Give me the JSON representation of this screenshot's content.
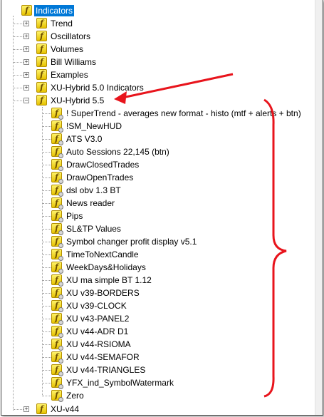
{
  "tree": {
    "root": {
      "label": "Indicators",
      "icon": "indicator-folder-icon"
    },
    "folders": [
      {
        "label": "Trend",
        "expander": "+"
      },
      {
        "label": "Oscillators",
        "expander": "+"
      },
      {
        "label": "Volumes",
        "expander": "+"
      },
      {
        "label": "Bill Williams",
        "expander": "+"
      },
      {
        "label": "Examples",
        "expander": "+"
      },
      {
        "label": "XU-Hybrid 5.0 Indicators",
        "expander": "+"
      },
      {
        "label": "XU-Hybrid 5.5",
        "expander": "−"
      }
    ],
    "items": [
      {
        "label": "! SuperTrend - averages new format - histo  (mtf + alerts + btn)"
      },
      {
        "label": "!SM_NewHUD"
      },
      {
        "label": "ATS V3.0"
      },
      {
        "label": "Auto Sessions 22,145 (btn)"
      },
      {
        "label": "DrawClosedTrades"
      },
      {
        "label": "DrawOpenTrades"
      },
      {
        "label": "dsl obv 1.3 BT"
      },
      {
        "label": "News reader"
      },
      {
        "label": "Pips"
      },
      {
        "label": "SL&TP Values"
      },
      {
        "label": "Symbol changer profit display v5.1"
      },
      {
        "label": "TimeToNextCandle"
      },
      {
        "label": "WeekDays&Holidays"
      },
      {
        "label": "XU ma simple BT 1.12"
      },
      {
        "label": "XU v39-BORDERS"
      },
      {
        "label": "XU v39-CLOCK"
      },
      {
        "label": "XU v43-PANEL2"
      },
      {
        "label": "XU v44-ADR D1"
      },
      {
        "label": "XU v44-RSIOMA"
      },
      {
        "label": "XU v44-SEMAFOR"
      },
      {
        "label": "XU v44-TRIANGLES"
      },
      {
        "label": "YFX_ind_SymbolWatermark"
      },
      {
        "label": "Zero"
      }
    ],
    "last_folder": {
      "label": "XU-v44",
      "expander": "+"
    }
  },
  "colors": {
    "selection": "#0078d7",
    "annotation": "#e8141c",
    "icon": "#f5d800"
  }
}
